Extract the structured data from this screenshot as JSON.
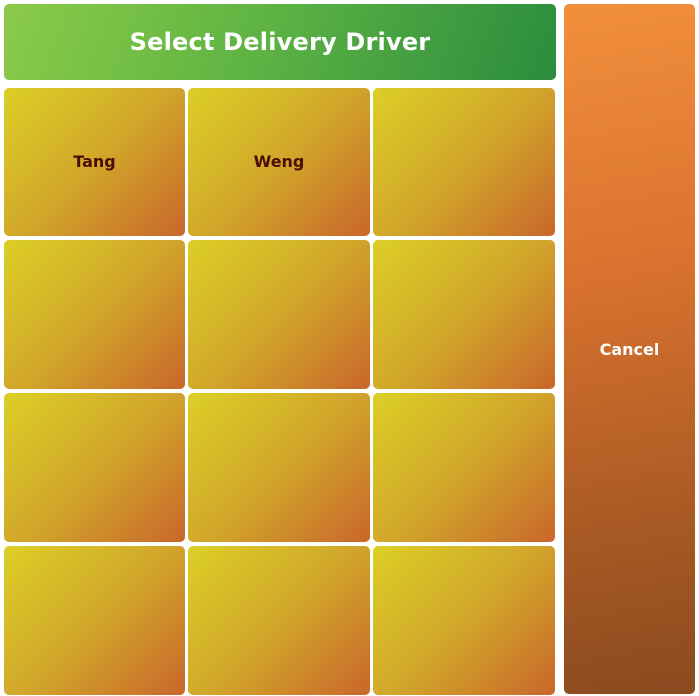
{
  "header": {
    "title": "Select Delivery Driver"
  },
  "drivers": [
    {
      "label": "Tang"
    },
    {
      "label": "Weng"
    },
    {
      "label": ""
    },
    {
      "label": ""
    },
    {
      "label": ""
    },
    {
      "label": ""
    },
    {
      "label": ""
    },
    {
      "label": ""
    },
    {
      "label": ""
    },
    {
      "label": ""
    },
    {
      "label": ""
    },
    {
      "label": ""
    }
  ],
  "actions": {
    "cancel_label": "Cancel"
  },
  "colors": {
    "title_bar": "#5fb443",
    "tile": "#d1a72a",
    "tile_text": "#4a0d08",
    "cancel": "#d8712e"
  }
}
